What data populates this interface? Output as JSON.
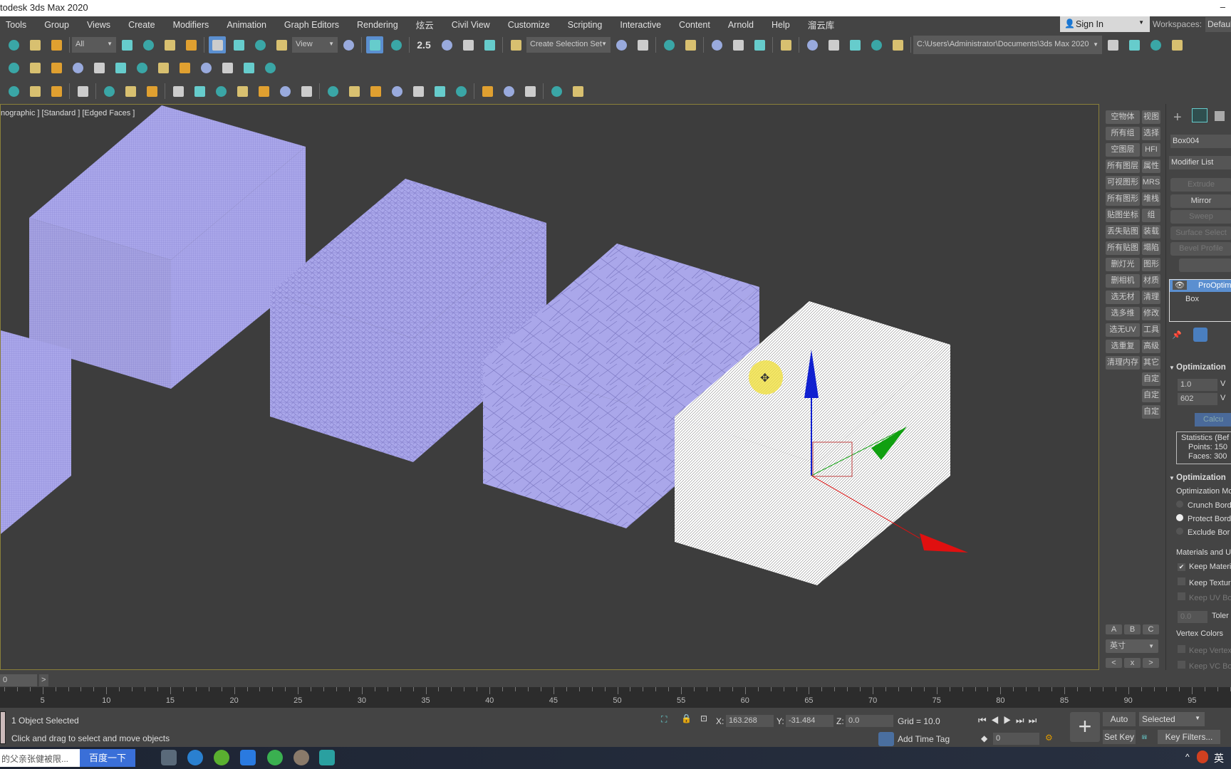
{
  "title": "todesk 3ds Max 2020",
  "menu": [
    "Tools",
    "Group",
    "Views",
    "Create",
    "Modifiers",
    "Animation",
    "Graph Editors",
    "Rendering",
    "炫云",
    "Civil View",
    "Customize",
    "Scripting",
    "Interactive",
    "Content",
    "Arnold",
    "Help",
    "溜云库"
  ],
  "account": {
    "sign_in": "Sign In",
    "workspaces_label": "Workspaces:",
    "workspace": "Default"
  },
  "toolbar1": {
    "selection_filter": "All",
    "ref_coord": "View",
    "named_selection": "Create Selection Set",
    "project_path": "C:\\Users\\Administrator\\Documents\\3ds Max 2020",
    "snap_label": "2.5"
  },
  "toolbar1_icons": [
    "link-icon",
    "unlink-icon",
    "bind-space-warp-icon",
    "sep",
    "FILTER",
    "select-object-icon",
    "select-by-name-icon",
    "rect-selection-icon",
    "window-crossing-icon",
    "sep",
    "move-icon",
    "rotate-icon",
    "scale-icon",
    "placement-icon",
    "REF",
    "pivot-icon",
    "sep",
    "manipulate-icon",
    "keyboard-shortcut-icon",
    "sep",
    "snap-toggle-icon",
    "angle-snap-icon",
    "percent-snap-icon",
    "spinner-snap-icon",
    "sep",
    "edit-named-sets-icon",
    "NAMED",
    "mirror-icon",
    "align-icon",
    "sep",
    "scene-explorer-icon",
    "layer-explorer-icon",
    "sep",
    "toggle-ribbon-icon",
    "curve-editor-icon",
    "dope-sheet-icon",
    "sep",
    "schematic-view-icon",
    "sep",
    "render-setup-icon",
    "rendered-frame-icon",
    "render-icon",
    "render-cloud-icon",
    "material-editor-icon",
    "sep",
    "PROJECT",
    "project-icon-1",
    "project-icon-2",
    "project-icon-3",
    "project-icon-4"
  ],
  "toolbar2_icons": [
    "plant-icon",
    "tree-icon",
    "billboard-icon",
    "conifer-icon",
    "light-icon",
    "refresh-icon",
    "viewport-icon",
    "grid-icon",
    "render-view-icon",
    "camera-icon",
    "window-icon",
    "teapot-icon",
    "bulb-icon"
  ],
  "toolbar3_icons": [
    "list-icon",
    "table-icon",
    "table2-icon",
    "sep",
    "light-bulb-icon",
    "sep",
    "camera-target-icon",
    "sphere-half-icon",
    "camera-free-icon",
    "sep",
    "plane-icon",
    "dome-icon",
    "disc-icon",
    "teapot2-icon",
    "cone-icon",
    "sun-icon",
    "sphere-icon",
    "sep",
    "mesh-icon",
    "molecule-icon",
    "tower-icon",
    "gear-blob-icon",
    "grass-icon",
    "hair-icon",
    "ox-icon",
    "sep",
    "material-sphere-icon",
    "render-map-icon",
    "render-region-icon",
    "sep",
    "document-icon",
    "help-icon"
  ],
  "viewport": {
    "label": "nographic ] [Standard ] [Edged Faces ]",
    "mesh_color": "#aaa7ea",
    "selected_color": "#ffffff",
    "axis_colors": {
      "x": "#e01010",
      "y": "#10a010",
      "z": "#1020d0"
    }
  },
  "quick_buttons": [
    [
      "空物体",
      "视图"
    ],
    [
      "所有组",
      "选择"
    ],
    [
      "空图层",
      "HFI"
    ],
    [
      "所有图层",
      "属性"
    ],
    [
      "可视图形",
      "MRS"
    ],
    [
      "所有图形",
      "堆栈"
    ],
    [
      "贴图坐标",
      "组"
    ],
    [
      "丢失贴图",
      "装载"
    ],
    [
      "所有贴图",
      "塌陷"
    ],
    [
      "删灯光",
      "图形"
    ],
    [
      "删相机",
      "材质"
    ],
    [
      "选无材",
      "清理"
    ],
    [
      "选多维",
      "修改"
    ],
    [
      "选无UV",
      "工具"
    ],
    [
      "选重复",
      "高级"
    ],
    [
      "清理内存",
      "其它"
    ],
    [
      "",
      "自定"
    ],
    [
      "",
      "自定"
    ],
    [
      "",
      "自定"
    ]
  ],
  "quick_bottom": {
    "a": "A",
    "b": "B",
    "c": "C",
    "unit": "英寸",
    "prev": "<",
    "close": "x",
    "next": ">"
  },
  "command_panel": {
    "object_name": "Box004",
    "modifier_list": "Modifier List",
    "buttons": [
      {
        "label": "Extrude",
        "enabled": false
      },
      {
        "label": "Mirror",
        "enabled": true
      },
      {
        "label": "Sweep",
        "enabled": false
      },
      {
        "label": "Surface Select",
        "enabled": false
      },
      {
        "label": "Bevel Profile",
        "enabled": false
      },
      {
        "label": "",
        "enabled": false
      }
    ],
    "stack": [
      "ProOptim",
      "Box"
    ],
    "rollout1": "Optimization",
    "vertex_percent": "1.0",
    "vertex_count": "602",
    "vertex_suffix": "V",
    "calculate": "Calcu",
    "stats": [
      "Statistics (Bef",
      "Points: 150",
      "Faces: 300"
    ],
    "rollout2": "Optimization",
    "opt_mode": "Optimization Mo",
    "radios": [
      {
        "label": "Crunch Bord",
        "checked": false
      },
      {
        "label": "Protect Bord",
        "checked": true
      },
      {
        "label": "Exclude Bor",
        "checked": false
      }
    ],
    "materials_group": "Materials and U",
    "checks": [
      {
        "label": "Keep Materia",
        "checked": true,
        "enabled": true
      },
      {
        "label": "Keep Texture",
        "checked": false,
        "enabled": true
      },
      {
        "label": "Keep UV Bou",
        "checked": false,
        "enabled": false
      }
    ],
    "tolerance_value": "0.0",
    "tolerance_label": "Toler",
    "vertex_colors": "Vertex Colors",
    "vc_checks": [
      "Keep Vertex",
      "Keep VC Bou"
    ]
  },
  "timeline": {
    "frame_display": "0",
    "next": ">",
    "ticks": [
      5,
      10,
      15,
      20,
      25,
      30,
      35,
      40,
      45,
      50,
      55,
      60,
      65,
      70,
      75,
      80,
      85,
      90,
      95
    ]
  },
  "status": {
    "selection": "1 Object Selected",
    "prompt": "Click and drag to select and move objects",
    "x_label": "X:",
    "x": "163.268",
    "y_label": "Y:",
    "y": "-31.484",
    "z_label": "Z:",
    "z": "0.0",
    "grid": "Grid = 10.0",
    "add_time_tag": "Add Time Tag",
    "auto_key": "Auto Key",
    "set_key": "Set Key",
    "key_mode": "Selected",
    "key_filters": "Key Filters...",
    "current_frame": "0"
  },
  "taskbar": {
    "search_text": "的父亲张健被限...",
    "search_button": "百度一下",
    "lang": "英"
  }
}
